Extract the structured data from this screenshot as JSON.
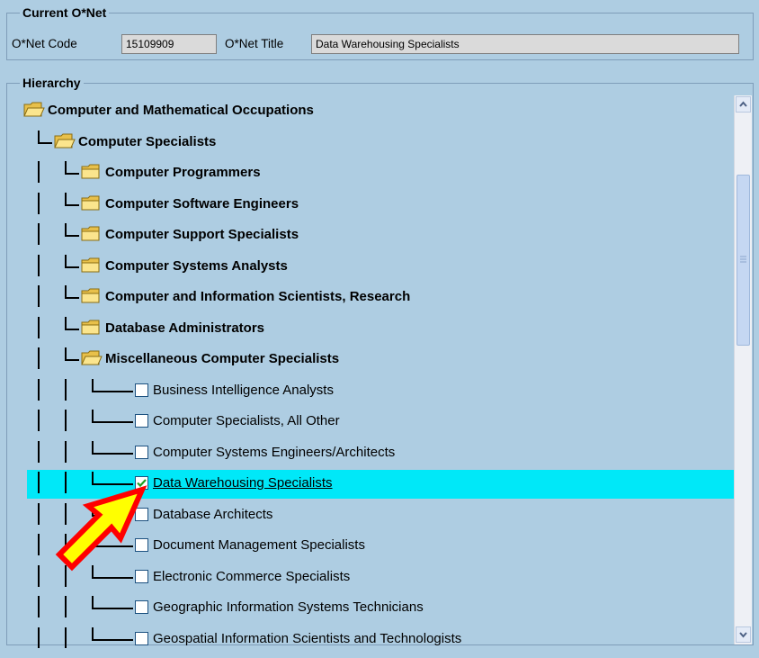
{
  "current": {
    "legend": "Current O*Net",
    "code_label": "O*Net Code",
    "code_value": "15109909",
    "title_label": "O*Net Title",
    "title_value": "Data Warehousing Specialists"
  },
  "hierarchy": {
    "legend": "Hierarchy",
    "items": [
      {
        "label": "Computer and Mathematical Occupations",
        "kind": "folder-open"
      },
      {
        "label": "Computer Specialists",
        "kind": "folder-open"
      },
      {
        "label": "Computer Programmers",
        "kind": "folder"
      },
      {
        "label": "Computer Software Engineers",
        "kind": "folder"
      },
      {
        "label": "Computer Support Specialists",
        "kind": "folder"
      },
      {
        "label": "Computer Systems Analysts",
        "kind": "folder"
      },
      {
        "label": "Computer and Information Scientists, Research",
        "kind": "folder"
      },
      {
        "label": "Database Administrators",
        "kind": "folder"
      },
      {
        "label": "Miscellaneous Computer Specialists",
        "kind": "folder-open"
      },
      {
        "label": "Business Intelligence Analysts",
        "kind": "checkbox",
        "checked": false
      },
      {
        "label": "Computer Specialists, All Other",
        "kind": "checkbox",
        "checked": false
      },
      {
        "label": "Computer Systems Engineers/Architects",
        "kind": "checkbox",
        "checked": false
      },
      {
        "label": "Data Warehousing Specialists",
        "kind": "checkbox",
        "checked": true,
        "selected": true
      },
      {
        "label": "Database Architects",
        "kind": "checkbox",
        "checked": false
      },
      {
        "label": "Document Management Specialists",
        "kind": "checkbox",
        "checked": false
      },
      {
        "label": "Electronic Commerce Specialists",
        "kind": "checkbox",
        "checked": false
      },
      {
        "label": "Geographic Information Systems Technicians",
        "kind": "checkbox",
        "checked": false
      },
      {
        "label": "Geospatial Information Scientists and Technologists",
        "kind": "checkbox",
        "checked": false
      }
    ]
  },
  "colors": {
    "background": "#aecde2",
    "selected_row": "#00e8f8",
    "arrow_fill": "#ffff00",
    "arrow_stroke": "#ff0000",
    "folder": "#f5d76e"
  },
  "icons": {
    "folder_open": "folder-open-icon",
    "folder": "folder-icon",
    "checkbox": "checkbox-icon",
    "checkmark": "checkmark-icon",
    "scroll_up": "scroll-up-icon",
    "scroll_down": "scroll-down-icon",
    "pointer_arrow": "pointer-arrow-icon"
  }
}
